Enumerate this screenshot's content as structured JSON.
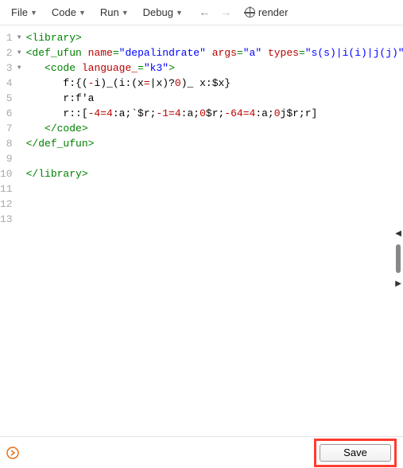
{
  "toolbar": {
    "menus": [
      "File",
      "Code",
      "Run",
      "Debug"
    ],
    "render_label": "render"
  },
  "editor": {
    "lines": [
      {
        "n": 1,
        "fold": true,
        "spans": [
          [
            "tag",
            "<library>"
          ]
        ]
      },
      {
        "n": 2,
        "fold": true,
        "spans": [
          [
            "tag",
            "<def_ufun"
          ],
          [
            "k-black",
            " "
          ],
          [
            "attr",
            "name"
          ],
          [
            "tag",
            "="
          ],
          [
            "str",
            "\"depalindrate\""
          ],
          [
            "k-black",
            " "
          ],
          [
            "attr",
            "args"
          ],
          [
            "tag",
            "="
          ],
          [
            "str",
            "\"a\""
          ],
          [
            "k-black",
            " "
          ],
          [
            "attr",
            "types"
          ],
          [
            "tag",
            "="
          ],
          [
            "str",
            "\"s(s)|i(i)|j(j)\""
          ],
          [
            "tag",
            ">"
          ]
        ]
      },
      {
        "n": 3,
        "fold": true,
        "spans": [
          [
            "k-black",
            "   "
          ],
          [
            "tag",
            "<code"
          ],
          [
            "k-black",
            " "
          ],
          [
            "attr",
            "language_"
          ],
          [
            "tag",
            "="
          ],
          [
            "str",
            "\"k3\""
          ],
          [
            "tag",
            ">"
          ]
        ]
      },
      {
        "n": 4,
        "fold": false,
        "spans": [
          [
            "k-black",
            "      f:{("
          ],
          [
            "k-red",
            "-"
          ],
          [
            "k-black",
            "i)_(i:(x"
          ],
          [
            "k-red",
            "="
          ],
          [
            "k-black",
            "|x)?"
          ],
          [
            "k-red",
            "0"
          ],
          [
            "k-black",
            ")_ x:$x}"
          ]
        ]
      },
      {
        "n": 5,
        "fold": false,
        "spans": [
          [
            "k-black",
            "      r:f'a"
          ]
        ]
      },
      {
        "n": 6,
        "fold": false,
        "spans": [
          [
            "k-black",
            "      r::["
          ],
          [
            "k-red",
            "-4=4"
          ],
          [
            "k-black",
            ":a;`$r;"
          ],
          [
            "k-red",
            "-1=4"
          ],
          [
            "k-black",
            ":a;"
          ],
          [
            "k-red",
            "0"
          ],
          [
            "k-black",
            "$r;"
          ],
          [
            "k-red",
            "-64=4"
          ],
          [
            "k-black",
            ":a;"
          ],
          [
            "k-red",
            "0"
          ],
          [
            "k-black",
            "j$r;r]"
          ]
        ]
      },
      {
        "n": 7,
        "fold": false,
        "spans": [
          [
            "k-black",
            "   "
          ],
          [
            "tag",
            "</code>"
          ]
        ]
      },
      {
        "n": 8,
        "fold": false,
        "spans": [
          [
            "tag",
            "</def_ufun>"
          ]
        ]
      },
      {
        "n": 9,
        "fold": false,
        "spans": []
      },
      {
        "n": 10,
        "fold": false,
        "spans": [
          [
            "tag",
            "</library>"
          ]
        ]
      },
      {
        "n": 11,
        "fold": false,
        "spans": []
      },
      {
        "n": 12,
        "fold": false,
        "spans": []
      },
      {
        "n": 13,
        "fold": false,
        "spans": []
      }
    ]
  },
  "footer": {
    "save_label": "Save"
  }
}
